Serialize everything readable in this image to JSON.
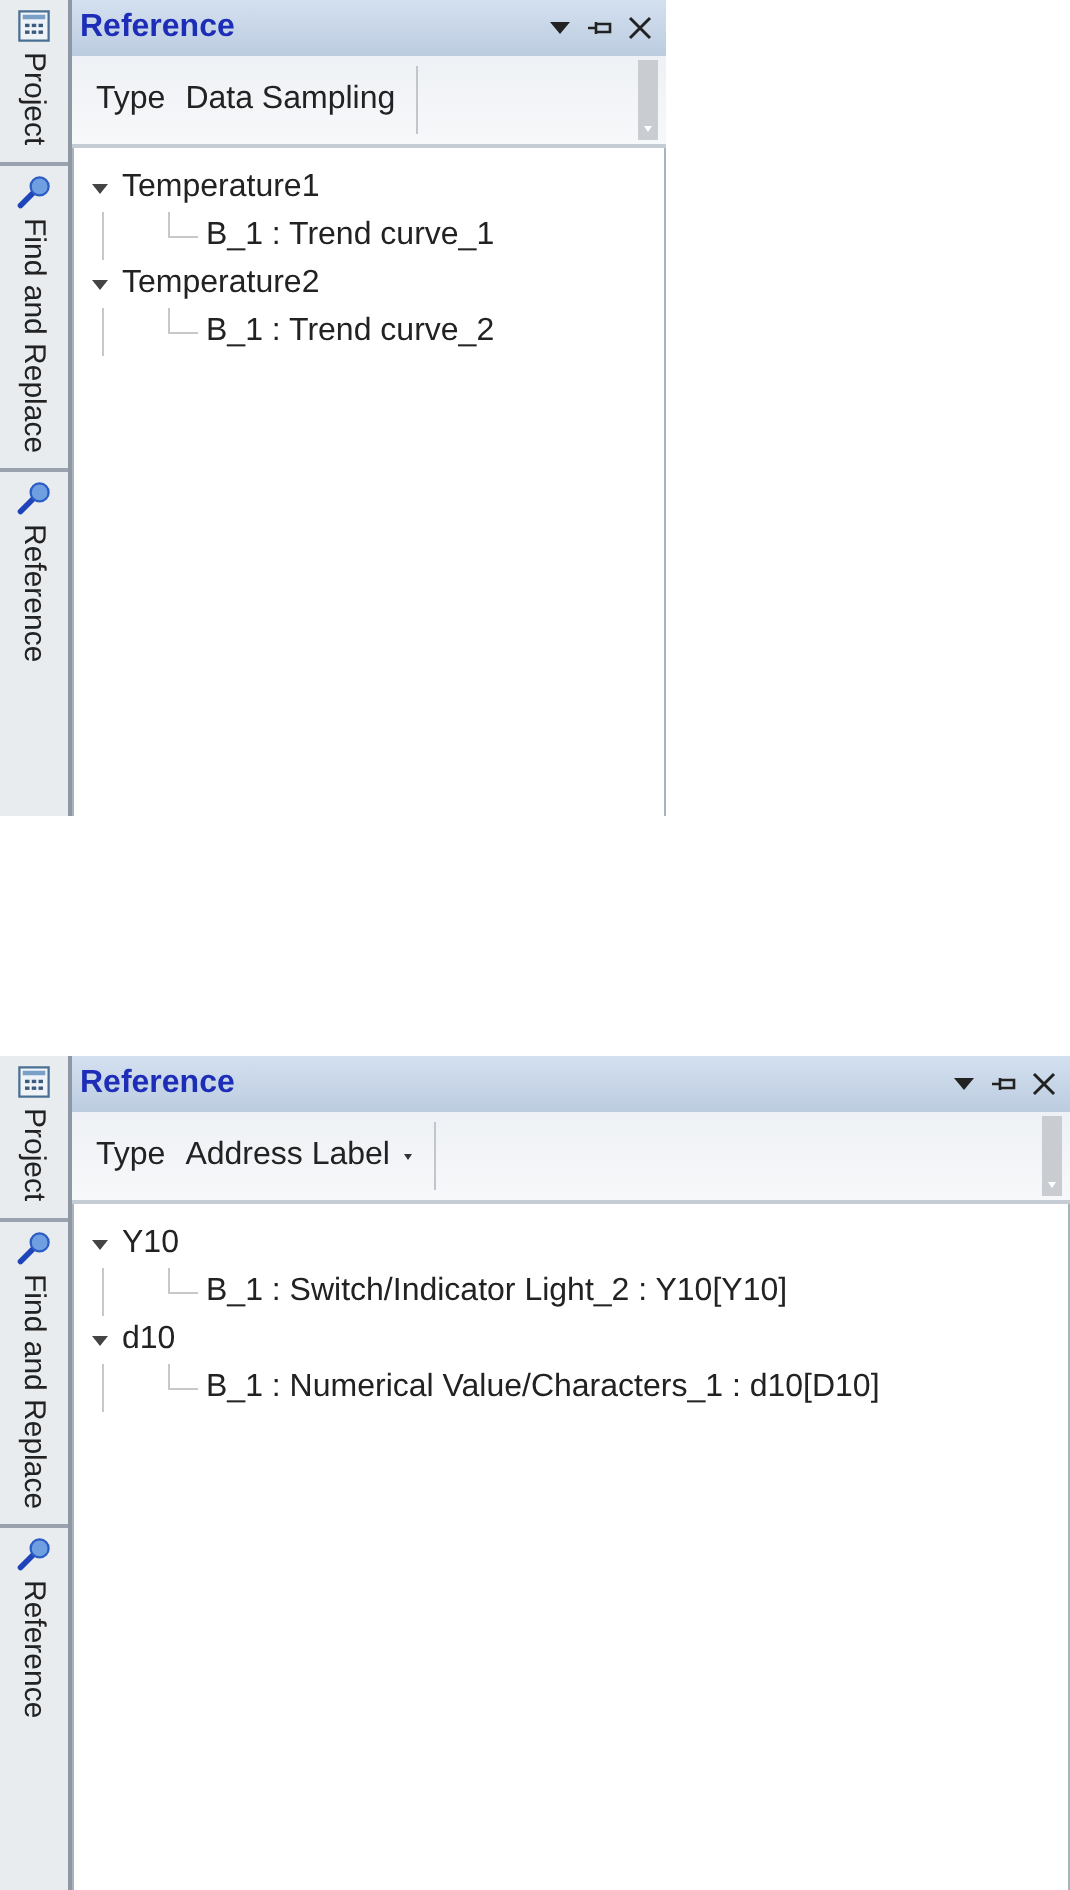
{
  "panels": [
    {
      "side_tabs": [
        {
          "label": "Project",
          "kind": "project"
        },
        {
          "label": "Find and Replace",
          "kind": "search"
        },
        {
          "label": "Reference",
          "kind": "search"
        }
      ],
      "title": "Reference",
      "toolbar": {
        "label": "Type",
        "value": "Data Sampling",
        "dropdown_arrow": false
      },
      "tree": [
        {
          "label": "Temperature1",
          "expanded": true,
          "children": [
            {
              "label": "B_1 : Trend curve_1"
            }
          ]
        },
        {
          "label": "Temperature2",
          "expanded": true,
          "children": [
            {
              "label": "B_1 : Trend curve_2"
            }
          ]
        }
      ]
    },
    {
      "side_tabs": [
        {
          "label": "Project",
          "kind": "project"
        },
        {
          "label": "Find and Replace",
          "kind": "search"
        },
        {
          "label": "Reference",
          "kind": "search"
        }
      ],
      "title": "Reference",
      "toolbar": {
        "label": "Type",
        "value": "Address Label",
        "dropdown_arrow": true
      },
      "tree": [
        {
          "label": "Y10",
          "expanded": true,
          "children": [
            {
              "label": "B_1 : Switch/Indicator Light_2 : Y10[Y10]"
            }
          ]
        },
        {
          "label": "d10",
          "expanded": true,
          "children": [
            {
              "label": "B_1 : Numerical Value/Characters_1 : d10[D10]"
            }
          ]
        }
      ]
    }
  ]
}
